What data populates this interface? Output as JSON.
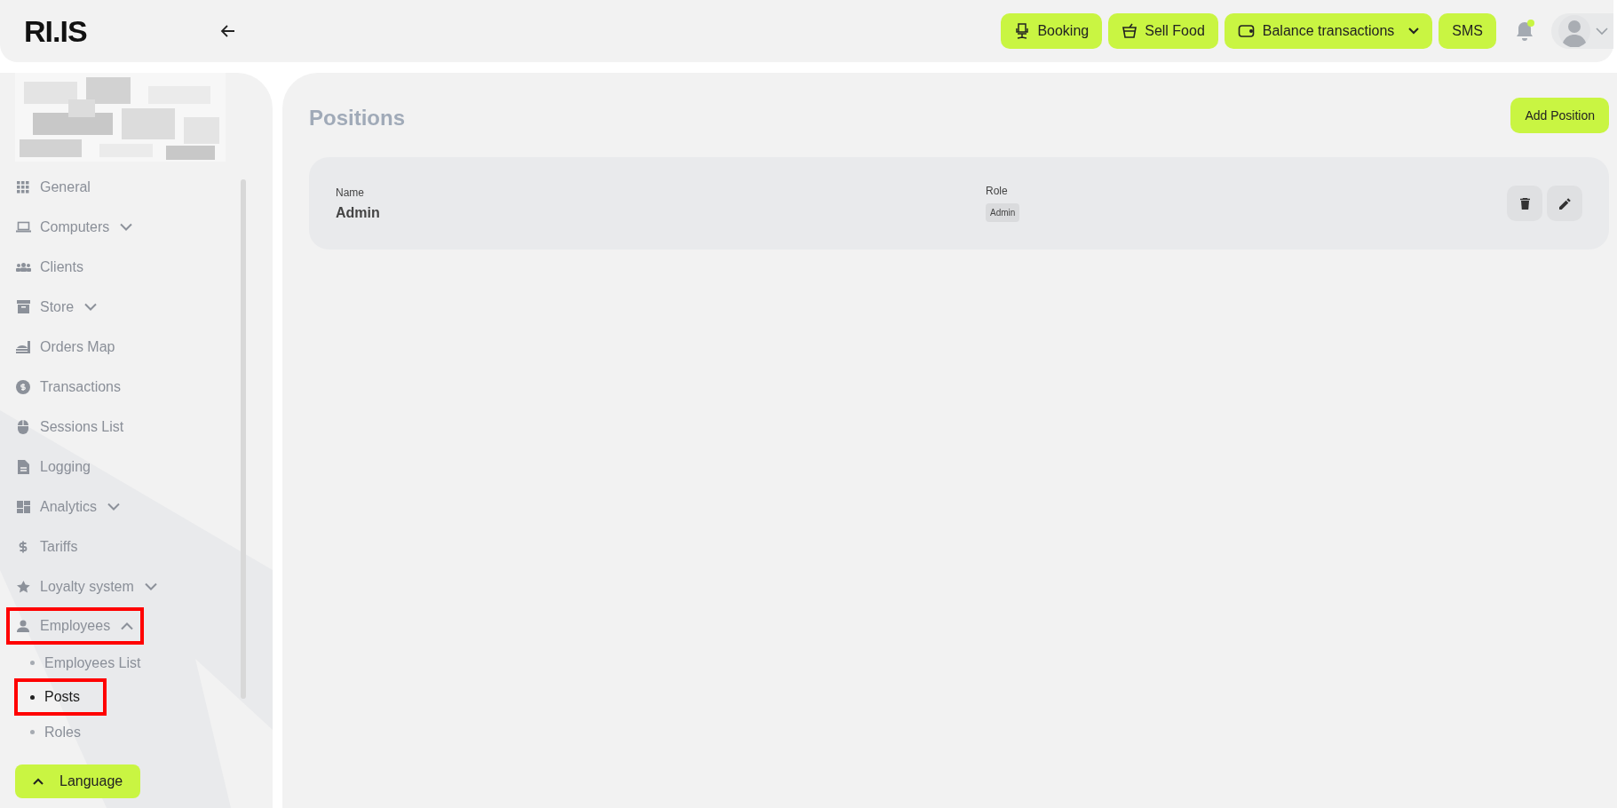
{
  "header": {
    "brand": "RI.IS",
    "actions": [
      {
        "label": "Booking",
        "dropdown": false
      },
      {
        "label": "Sell Food",
        "dropdown": false
      },
      {
        "label": "Balance transactions",
        "dropdown": true
      },
      {
        "label": "SMS",
        "dropdown": false
      }
    ],
    "notifications": {
      "unread": true
    }
  },
  "sidebar": {
    "items": [
      {
        "label": "General",
        "highlighted": false
      },
      {
        "label": "Computers",
        "expanded": false,
        "highlighted": false
      },
      {
        "label": "Clients",
        "highlighted": false
      },
      {
        "label": "Store",
        "expanded": false,
        "highlighted": false
      },
      {
        "label": "Orders Map",
        "highlighted": false
      },
      {
        "label": "Transactions",
        "highlighted": false
      },
      {
        "label": "Sessions List",
        "highlighted": false
      },
      {
        "label": "Logging",
        "highlighted": false
      },
      {
        "label": "Analytics",
        "expanded": false,
        "highlighted": false
      },
      {
        "label": "Tariffs",
        "highlighted": false
      },
      {
        "label": "Loyalty system",
        "expanded": false,
        "highlighted": false
      },
      {
        "label": "Employees",
        "expanded": true,
        "highlighted": true,
        "children": [
          {
            "label": "Employees List",
            "selected": false,
            "highlighted": false
          },
          {
            "label": "Posts",
            "selected": true,
            "highlighted": true
          },
          {
            "label": "Roles",
            "selected": false,
            "highlighted": false
          }
        ]
      }
    ],
    "language_button": "Language"
  },
  "main": {
    "title": "Positions",
    "add_button": "Add Position",
    "positions": [
      {
        "name_label": "Name",
        "name": "Admin",
        "role_label": "Role",
        "roles": [
          "Admin"
        ]
      }
    ]
  }
}
